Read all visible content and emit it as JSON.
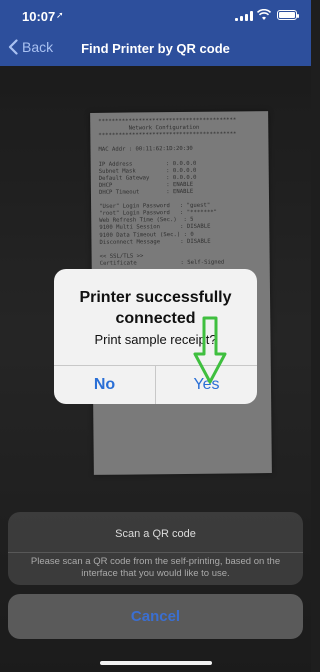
{
  "status_bar": {
    "time": "10:07",
    "location_glyph": "➚"
  },
  "nav": {
    "back_label": "Back",
    "title": "Find Printer by QR code"
  },
  "receipt": {
    "lines": "*****************************************\n         Network Configuration\n*****************************************\n\nMAC Addr : 00:11:62:1D:20:30\n\nIP Address          : 0.0.0.0\nSubnet Mask         : 0.0.0.0\nDefault Gateway     : 0.0.0.0\nDHCP                : ENABLE\nDHCP Timeout        : ENABLE\n\n\"User\" Login Password   : \"guest\"\n\"root\" Login Password   : \"*******\"\nWeb Refresh Time (Sec.)  : 5\n9100 Multi Session      : DISABLE\n9100 Data Timeout (Sec.) : 0\nDisconnect Message      : DISABLE\n\n<< SSL/TLS >>\nCertificate             : Self-Signed"
  },
  "alert": {
    "title": "Printer successfully connected",
    "message": "Print sample receipt?",
    "no_label": "No",
    "yes_label": "Yes"
  },
  "sheet": {
    "title": "Scan a QR code",
    "message": "Please scan a QR code from the self-printing, based on the interface that you would like to use."
  },
  "cancel_label": "Cancel",
  "colors": {
    "nav_bg": "#2d4f9c",
    "accent": "#2a6fd6",
    "arrow": "#3fbf3f"
  }
}
